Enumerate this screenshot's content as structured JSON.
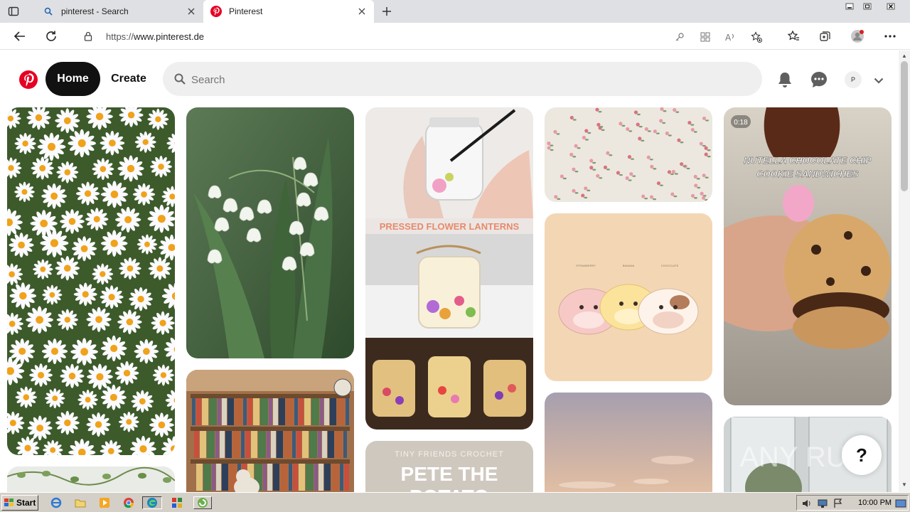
{
  "browser": {
    "tabs": [
      {
        "title": "pinterest - Search"
      },
      {
        "title": "Pinterest"
      }
    ],
    "url_prefix": "https://",
    "url_host": "www.pinterest.de"
  },
  "header": {
    "home_label": "Home",
    "create_label": "Create",
    "search_placeholder": "Search",
    "avatar_initial": "P"
  },
  "pins": {
    "video_duration": "0:18",
    "nutella_title_line1": "NUTELLA CHOCOLATE CHIP",
    "nutella_title_line2": "COOKIE SANDWICHES",
    "lanterns_title": "PRESSED FLOWER LANTERNS",
    "crochet_subtitle": "TINY FRIENDS CROCHET",
    "crochet_title_line1": "PETE THE",
    "crochet_title_line2": "POTATO",
    "cows_labels": [
      "STRAWBERRY",
      "BANANA",
      "CHOCOLATE"
    ],
    "watermark": "ANY RUN"
  },
  "help_label": "?",
  "taskbar": {
    "start_label": "Start",
    "clock": "10:00 PM"
  },
  "colors": {
    "pinterest_red": "#e60023",
    "home_bg": "#111111",
    "search_bg": "#efefef"
  }
}
